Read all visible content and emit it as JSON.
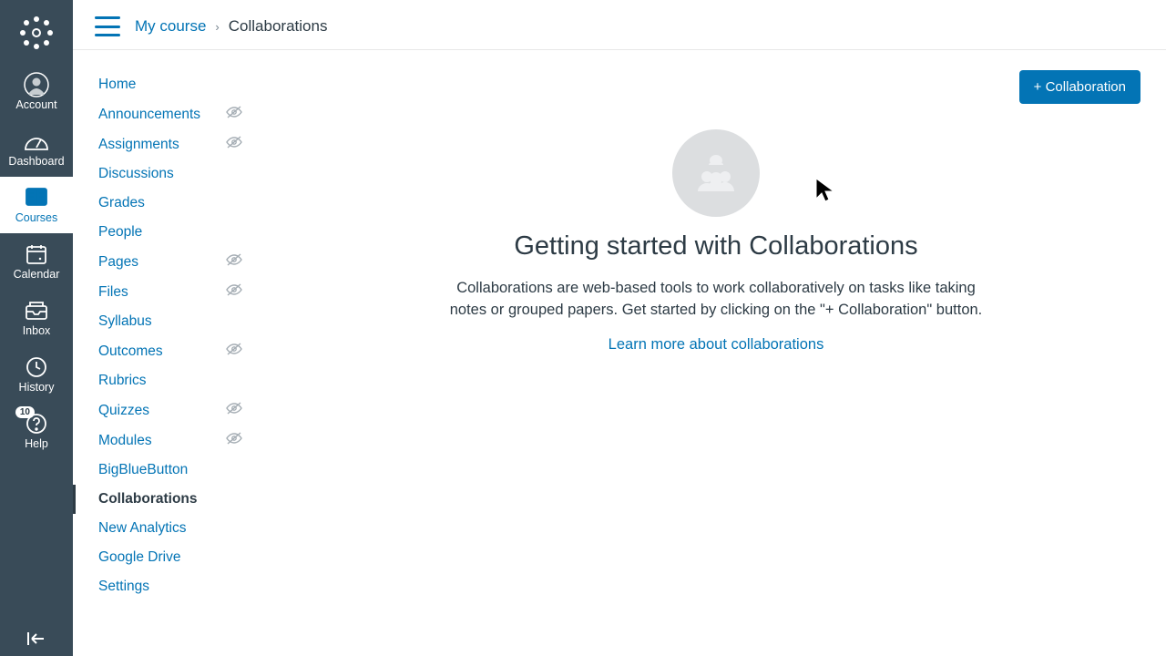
{
  "globalNav": {
    "items": [
      {
        "name": "account",
        "label": "Account"
      },
      {
        "name": "dashboard",
        "label": "Dashboard"
      },
      {
        "name": "courses",
        "label": "Courses"
      },
      {
        "name": "calendar",
        "label": "Calendar"
      },
      {
        "name": "inbox",
        "label": "Inbox"
      },
      {
        "name": "history",
        "label": "History"
      },
      {
        "name": "help",
        "label": "Help",
        "badge": "10"
      }
    ],
    "activeIndex": 2
  },
  "breadcrumb": {
    "course": "My course",
    "current": "Collaborations"
  },
  "courseNav": {
    "items": [
      {
        "label": "Home"
      },
      {
        "label": "Announcements",
        "hidden": true
      },
      {
        "label": "Assignments",
        "hidden": true
      },
      {
        "label": "Discussions"
      },
      {
        "label": "Grades"
      },
      {
        "label": "People"
      },
      {
        "label": "Pages",
        "hidden": true
      },
      {
        "label": "Files",
        "hidden": true
      },
      {
        "label": "Syllabus"
      },
      {
        "label": "Outcomes",
        "hidden": true
      },
      {
        "label": "Rubrics"
      },
      {
        "label": "Quizzes",
        "hidden": true
      },
      {
        "label": "Modules",
        "hidden": true
      },
      {
        "label": "BigBlueButton"
      },
      {
        "label": "Collaborations",
        "active": true
      },
      {
        "label": "New Analytics"
      },
      {
        "label": "Google Drive"
      },
      {
        "label": "Settings"
      }
    ]
  },
  "page": {
    "addButton": "+ Collaboration",
    "emptyTitle": "Getting started with Collaborations",
    "emptyBody": "Collaborations are web-based tools to work collaboratively on tasks like taking notes or grouped papers. Get started by clicking on the \"+ Collaboration\" button.",
    "learnLink": "Learn more about collaborations"
  },
  "colors": {
    "brand": "#0374b5",
    "navBg": "#394b58"
  }
}
